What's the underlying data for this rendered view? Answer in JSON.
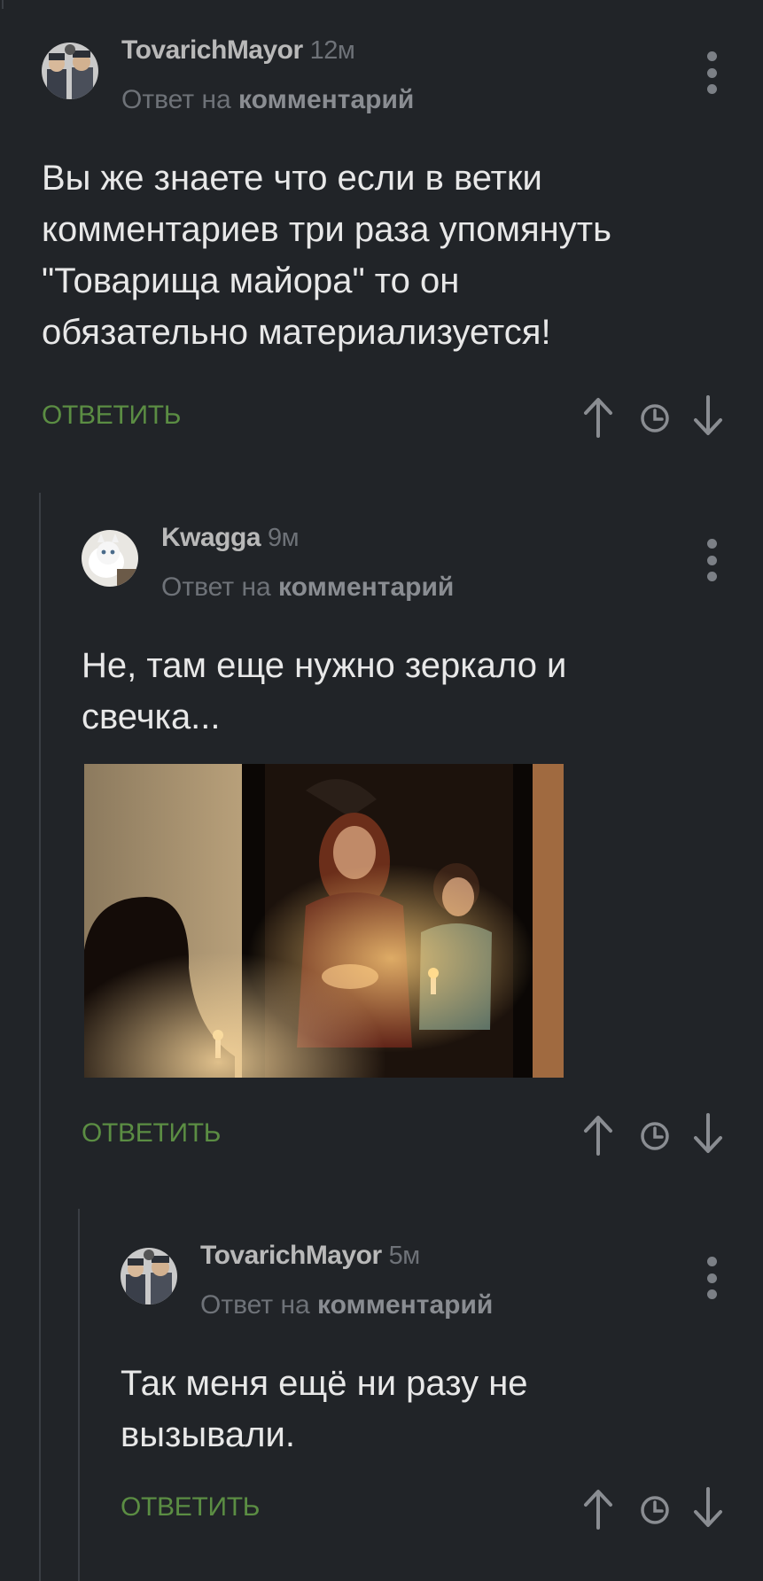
{
  "comments": [
    {
      "author": "TovarichMayor",
      "time": "12м",
      "reply_prefix": "Ответ на",
      "reply_link": "комментарий",
      "body_lines": [
        "Вы же знаете что если в ветки",
        "комментариев три раза упомянуть",
        "\"Товарища майора\" то он",
        "обязательно материализуется!"
      ],
      "reply_label": "ОТВЕТИТЬ"
    },
    {
      "author": "Kwagga",
      "time": "9м",
      "reply_prefix": "Ответ на",
      "reply_link": "комментарий",
      "body_lines": [
        "Не, там еще нужно зеркало и",
        "свечка..."
      ],
      "reply_label": "ОТВЕТИТЬ"
    },
    {
      "author": "TovarichMayor",
      "time": "5м",
      "reply_prefix": "Ответ на",
      "reply_link": "комментарий",
      "body_lines": [
        "Так меня ещё ни разу не",
        "вызывали."
      ],
      "reply_label": "ОТВЕТИТЬ"
    }
  ],
  "icons": {
    "menu": "kebab-menu-icon",
    "up": "arrow-up-icon",
    "clock": "clock-icon",
    "down": "arrow-down-icon"
  },
  "colors": {
    "background": "#212428",
    "reply_green": "#5b8d43",
    "text": "#e8e8e8",
    "muted": "#6e7278"
  }
}
